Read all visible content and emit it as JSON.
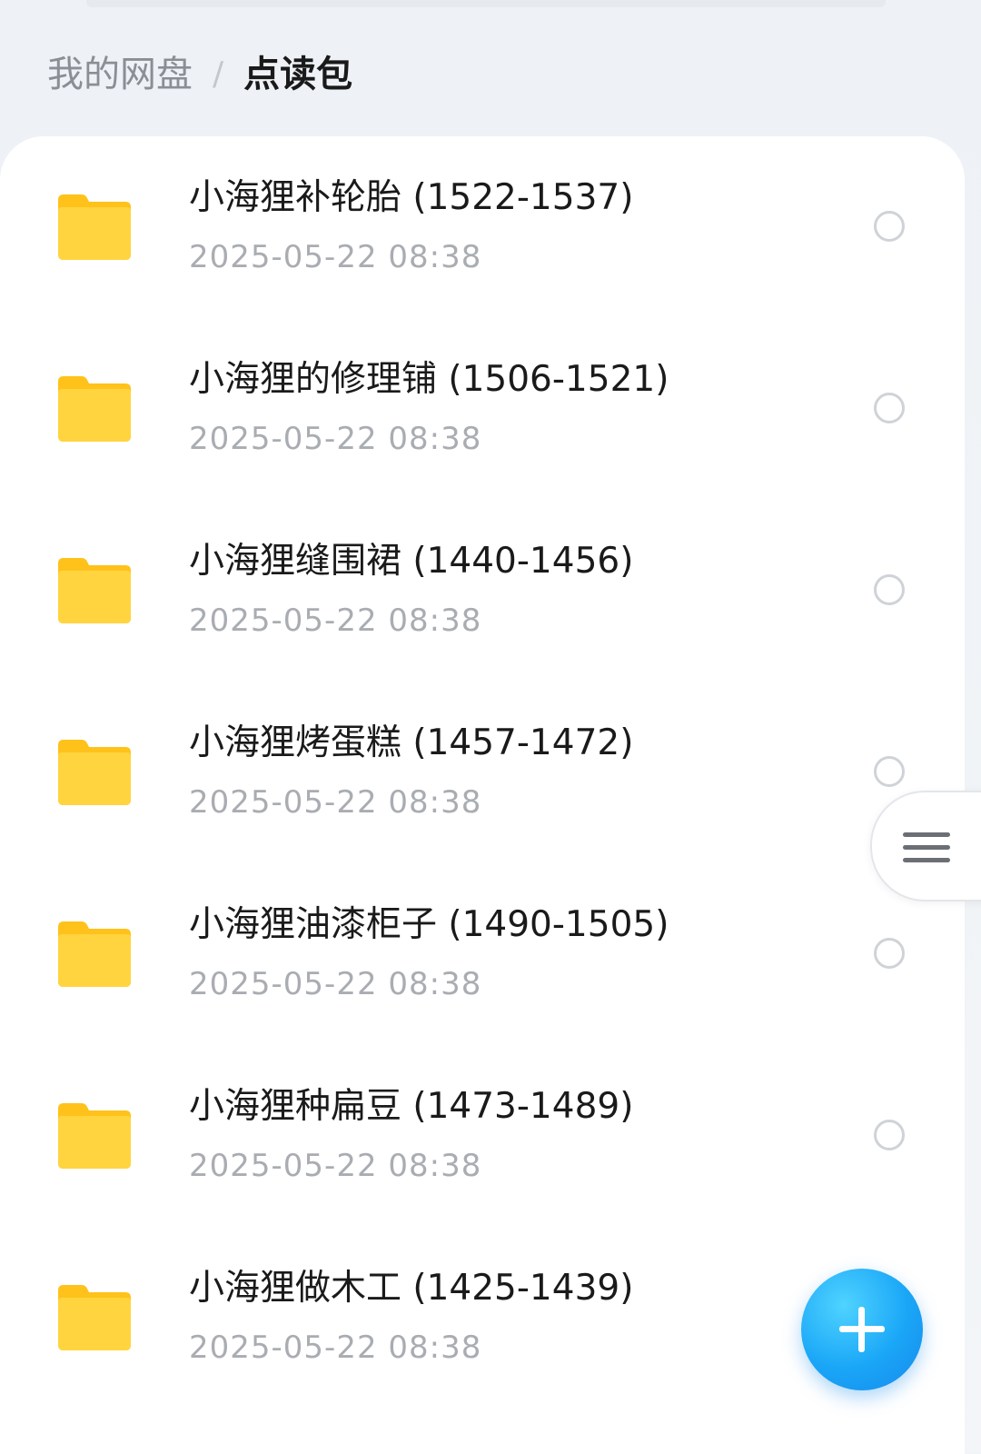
{
  "breadcrumb": {
    "root": "我的网盘",
    "separator": "/",
    "current": "点读包"
  },
  "files": [
    {
      "name": "小海狸补轮胎 (1522-1537)",
      "date": "2025-05-22  08:38",
      "icon": "folder-icon"
    },
    {
      "name": "小海狸的修理铺 (1506-1521)",
      "date": "2025-05-22  08:38",
      "icon": "folder-icon"
    },
    {
      "name": "小海狸缝围裙 (1440-1456)",
      "date": "2025-05-22  08:38",
      "icon": "folder-icon"
    },
    {
      "name": "小海狸烤蛋糕 (1457-1472)",
      "date": "2025-05-22  08:38",
      "icon": "folder-icon"
    },
    {
      "name": "小海狸油漆柜子 (1490-1505)",
      "date": "2025-05-22  08:38",
      "icon": "folder-icon"
    },
    {
      "name": "小海狸种扁豆 (1473-1489)",
      "date": "2025-05-22  08:38",
      "icon": "folder-icon"
    },
    {
      "name": "小海狸做木工 (1425-1439)",
      "date": "2025-05-22  08:38",
      "icon": "folder-icon"
    }
  ],
  "side_menu": {
    "icon": "menu-icon"
  },
  "fab": {
    "icon": "plus-icon"
  },
  "colors": {
    "folder_top": "#ffd23a",
    "folder_bottom": "#ffc21a",
    "accent": "#1aa6f7"
  }
}
